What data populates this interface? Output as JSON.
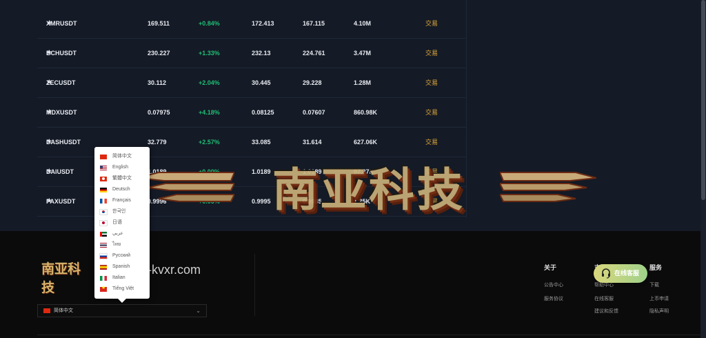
{
  "market": {
    "rows": [
      {
        "symbol": "XMRUSDT",
        "price": "169.511",
        "change": "+0.84%",
        "high": "172.413",
        "low": "167.115",
        "volume": "4.10M",
        "action": "交易"
      },
      {
        "symbol": "BCHUSDT",
        "price": "230.227",
        "change": "+1.33%",
        "high": "232.13",
        "low": "224.761",
        "volume": "3.47M",
        "action": "交易"
      },
      {
        "symbol": "ZECUSDT",
        "price": "30.112",
        "change": "+2.04%",
        "high": "30.445",
        "low": "29.228",
        "volume": "1.28M",
        "action": "交易"
      },
      {
        "symbol": "MDXUSDT",
        "price": "0.07975",
        "change": "+4.18%",
        "high": "0.08125",
        "low": "0.07607",
        "volume": "860.98K",
        "action": "交易"
      },
      {
        "symbol": "DASHUSDT",
        "price": "32.779",
        "change": "+2.57%",
        "high": "33.085",
        "low": "31.614",
        "volume": "627.06K",
        "action": "交易"
      },
      {
        "symbol": "DAIUSDT",
        "price": "1.0189",
        "change": "+0.00%",
        "high": "1.0189",
        "low": "1.0189",
        "volume": "97.87K",
        "action": "交易"
      },
      {
        "symbol": "PAXUSDT",
        "price": "0.9996",
        "change": "+0.06%",
        "high": "0.9995",
        "low": "0.9985",
        "volume": "1.35K",
        "action": "交易"
      }
    ]
  },
  "watermark": {
    "text": "南亚科技"
  },
  "footer": {
    "logo_text": "南亚科技",
    "domain": "-kvxr.com",
    "language_selected": "简体中文",
    "columns": [
      {
        "title": "关于",
        "links": [
          "公告中心",
          "服务协议"
        ]
      },
      {
        "title": "支持",
        "links": [
          "帮助中心",
          "在线客服",
          "建议和反馈"
        ]
      },
      {
        "title": "服务",
        "links": [
          "下载",
          "上币申请",
          "隐私声明"
        ]
      }
    ]
  },
  "language_menu": {
    "items": [
      {
        "name": "简体中文",
        "flag": "cn"
      },
      {
        "name": "English",
        "flag": "us"
      },
      {
        "name": "繁體中文",
        "flag": "hk"
      },
      {
        "name": "Deutsch",
        "flag": "de"
      },
      {
        "name": "Français",
        "flag": "fr"
      },
      {
        "name": "한국인",
        "flag": "kr"
      },
      {
        "name": "日语",
        "flag": "jp"
      },
      {
        "name": "عربي",
        "flag": "ae"
      },
      {
        "name": "ไทย",
        "flag": "th"
      },
      {
        "name": "Русский",
        "flag": "ru"
      },
      {
        "name": "Spanish",
        "flag": "es"
      },
      {
        "name": "Italian",
        "flag": "it"
      },
      {
        "name": "Tiếng Việt",
        "flag": "vn"
      }
    ]
  },
  "chat": {
    "label": "在线客服",
    "icon": "headset-icon"
  },
  "icons": {
    "star": "star-icon",
    "chevron": "chevron-down-icon"
  },
  "colors": {
    "positive": "#1fbf75",
    "trade_link": "#e0a93c",
    "background": "#141a26"
  }
}
